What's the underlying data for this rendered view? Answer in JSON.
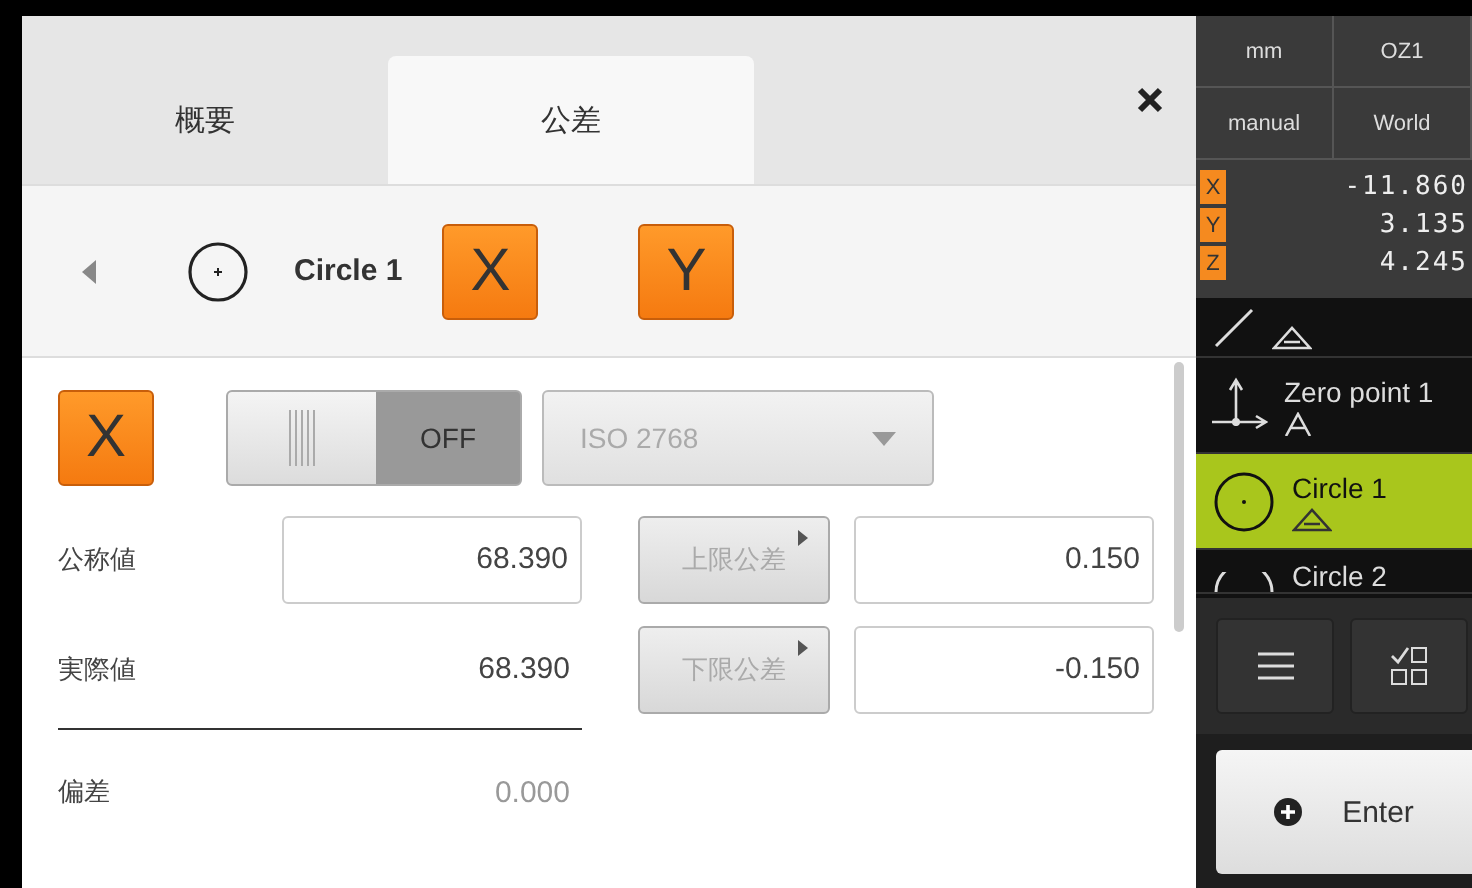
{
  "tabs": [
    {
      "label": "概要",
      "selected": false
    },
    {
      "label": "公差",
      "selected": true
    }
  ],
  "header": {
    "feature_name": "Circle 1",
    "axes": [
      "X",
      "Y"
    ]
  },
  "axis_row": {
    "axis": "X",
    "toggle": {
      "on": false,
      "label": "OFF"
    },
    "standard": {
      "value": "ISO 2768",
      "disabled": true
    }
  },
  "values": [
    {
      "label": "公称値",
      "value": "68.390",
      "kind": "field"
    },
    {
      "label": "実際値",
      "value": "68.390",
      "kind": "text"
    }
  ],
  "tolerances": [
    {
      "label": "上限公差",
      "disabled": true,
      "value": "0.150"
    },
    {
      "label": "下限公差",
      "disabled": true,
      "value": "-0.150"
    }
  ],
  "deviation": {
    "label": "偏差",
    "value": "0.000"
  },
  "status": {
    "unit": "mm",
    "zero": "OZ1",
    "mode": "manual",
    "system": "World"
  },
  "positions": [
    {
      "axis": "X",
      "value": "-11.860"
    },
    {
      "axis": "Y",
      "value": "3.135"
    },
    {
      "axis": "Z",
      "value": "4.245"
    }
  ],
  "features": [
    {
      "kind": "line",
      "selected": false
    },
    {
      "kind": "zero",
      "name": "Zero point 1",
      "selected": false
    },
    {
      "kind": "circle",
      "name": "Circle 1",
      "selected": true
    },
    {
      "kind": "circle2",
      "name": "Circle 2",
      "selected": false
    }
  ],
  "enter_button": "Enter"
}
